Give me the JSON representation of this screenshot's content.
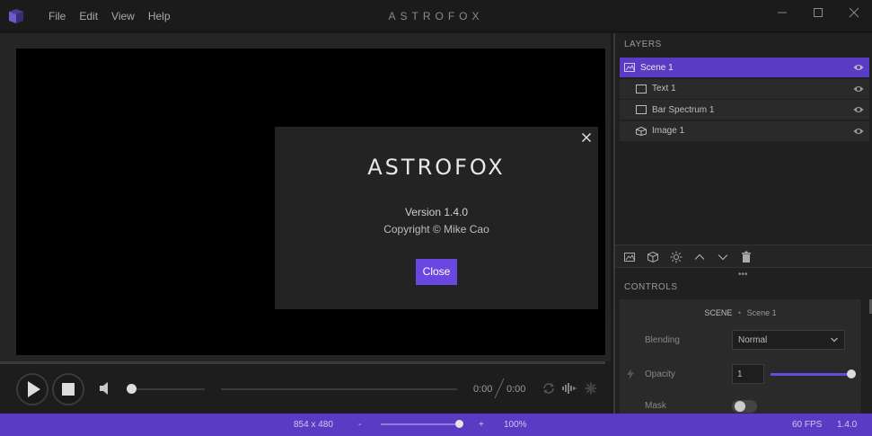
{
  "titlebar": {
    "app_title": "ASTROFOX",
    "menu": [
      {
        "label": "File"
      },
      {
        "label": "Edit"
      },
      {
        "label": "View"
      },
      {
        "label": "Help"
      }
    ],
    "controls": [
      "minimize-icon",
      "maximize-icon",
      "close-icon"
    ]
  },
  "layers": {
    "heading": "LAYERS",
    "items": [
      {
        "label": "Scene 1",
        "icon": "scene-icon",
        "selected": true
      },
      {
        "label": "Text 1",
        "icon": "text-layer-icon",
        "selected": false
      },
      {
        "label": "Bar Spectrum 1",
        "icon": "display-layer-icon",
        "selected": false
      },
      {
        "label": "Image 1",
        "icon": "image-layer-icon",
        "selected": false
      }
    ],
    "toolbar": [
      "add-scene-icon",
      "add-display-icon",
      "add-effect-icon",
      "move-up-icon",
      "move-down-icon",
      "delete-icon"
    ]
  },
  "controls": {
    "heading": "CONTROLS",
    "scene_type": "SCENE",
    "scene_name": "Scene 1",
    "blending": {
      "label": "Blending",
      "value": "Normal"
    },
    "opacity": {
      "label": "Opacity",
      "value": "1",
      "slider_fraction": 1.0
    },
    "mask": {
      "label": "Mask"
    }
  },
  "transport": {
    "current_time": "0:00",
    "total_time": "0:00",
    "volume_fraction": 0.0
  },
  "statusbar": {
    "resolution": "854 x 480",
    "zoom_minus": "-",
    "zoom_plus": "+",
    "zoom": "100%",
    "fps": "60 FPS",
    "version": "1.4.0"
  },
  "about_dialog": {
    "logo_text": "ASTROFOX",
    "version": "Version 1.4.0",
    "copyright": "Copyright © Mike Cao",
    "close_label": "Close"
  },
  "colors": {
    "accent": "#6a47e0",
    "status_bar": "#5a3cc4",
    "background": "#1b1b1b"
  }
}
